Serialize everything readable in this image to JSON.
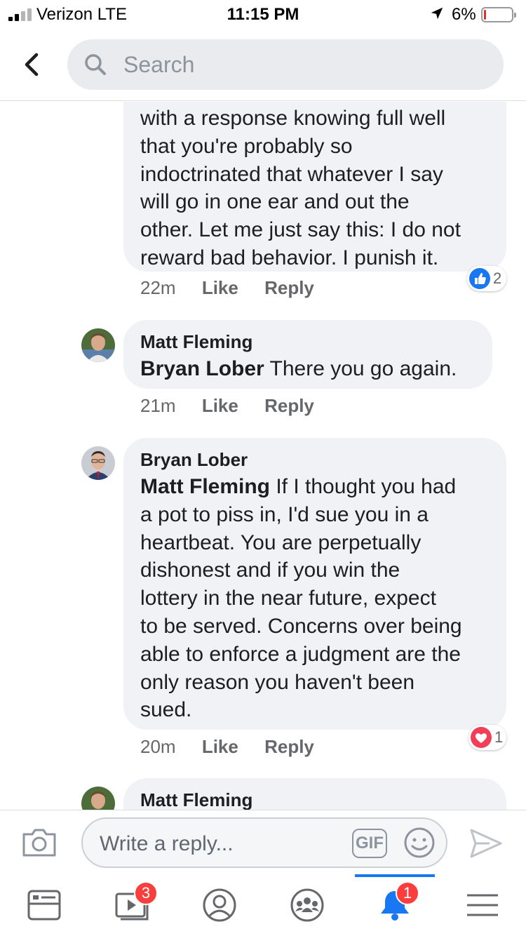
{
  "status_bar": {
    "carrier": "Verizon  LTE",
    "time": "11:15 PM",
    "battery_percent": "6%",
    "battery_level": 0.06
  },
  "header": {
    "search_placeholder": "Search"
  },
  "comments": [
    {
      "author": "",
      "text": "with a response knowing full well\nthat you're probably so\nindoctrinated that whatever I say\nwill go in one ear and out the\nother. Let me just say this: I do not\nreward bad behavior. I punish it.",
      "time": "22m",
      "like_label": "Like",
      "reply_label": "Reply",
      "reaction": {
        "type": "like",
        "color": "#1877f2",
        "count": "2"
      }
    },
    {
      "author": "Matt Fleming",
      "mention": "Bryan Lober",
      "text": " There you go again.",
      "time": "21m",
      "like_label": "Like",
      "reply_label": "Reply"
    },
    {
      "author": "Bryan Lober",
      "mention": "Matt Fleming",
      "text": " If I thought you had\na pot to piss in, I'd sue you in a\nheartbeat. You are perpetually\ndishonest and if you win the\nlottery in the near future, expect\nto be served. Concerns over being\nable to enforce a judgment are the\nonly reason you haven't been\nsued.",
      "time": "20m",
      "like_label": "Like",
      "reply_label": "Reply",
      "reaction": {
        "type": "love",
        "color": "#f33e58",
        "count": "1"
      }
    },
    {
      "author": "Matt Fleming"
    }
  ],
  "composer": {
    "placeholder": "Write a reply...",
    "gif_label": "GIF"
  },
  "tabbar": {
    "items": [
      {
        "icon": "news-feed-icon"
      },
      {
        "icon": "watch-video-icon",
        "badge": "3"
      },
      {
        "icon": "profile-icon"
      },
      {
        "icon": "groups-icon"
      },
      {
        "icon": "notifications-bell-icon",
        "badge": "1",
        "active": true
      },
      {
        "icon": "menu-icon"
      }
    ],
    "accent": "#1877f2"
  }
}
